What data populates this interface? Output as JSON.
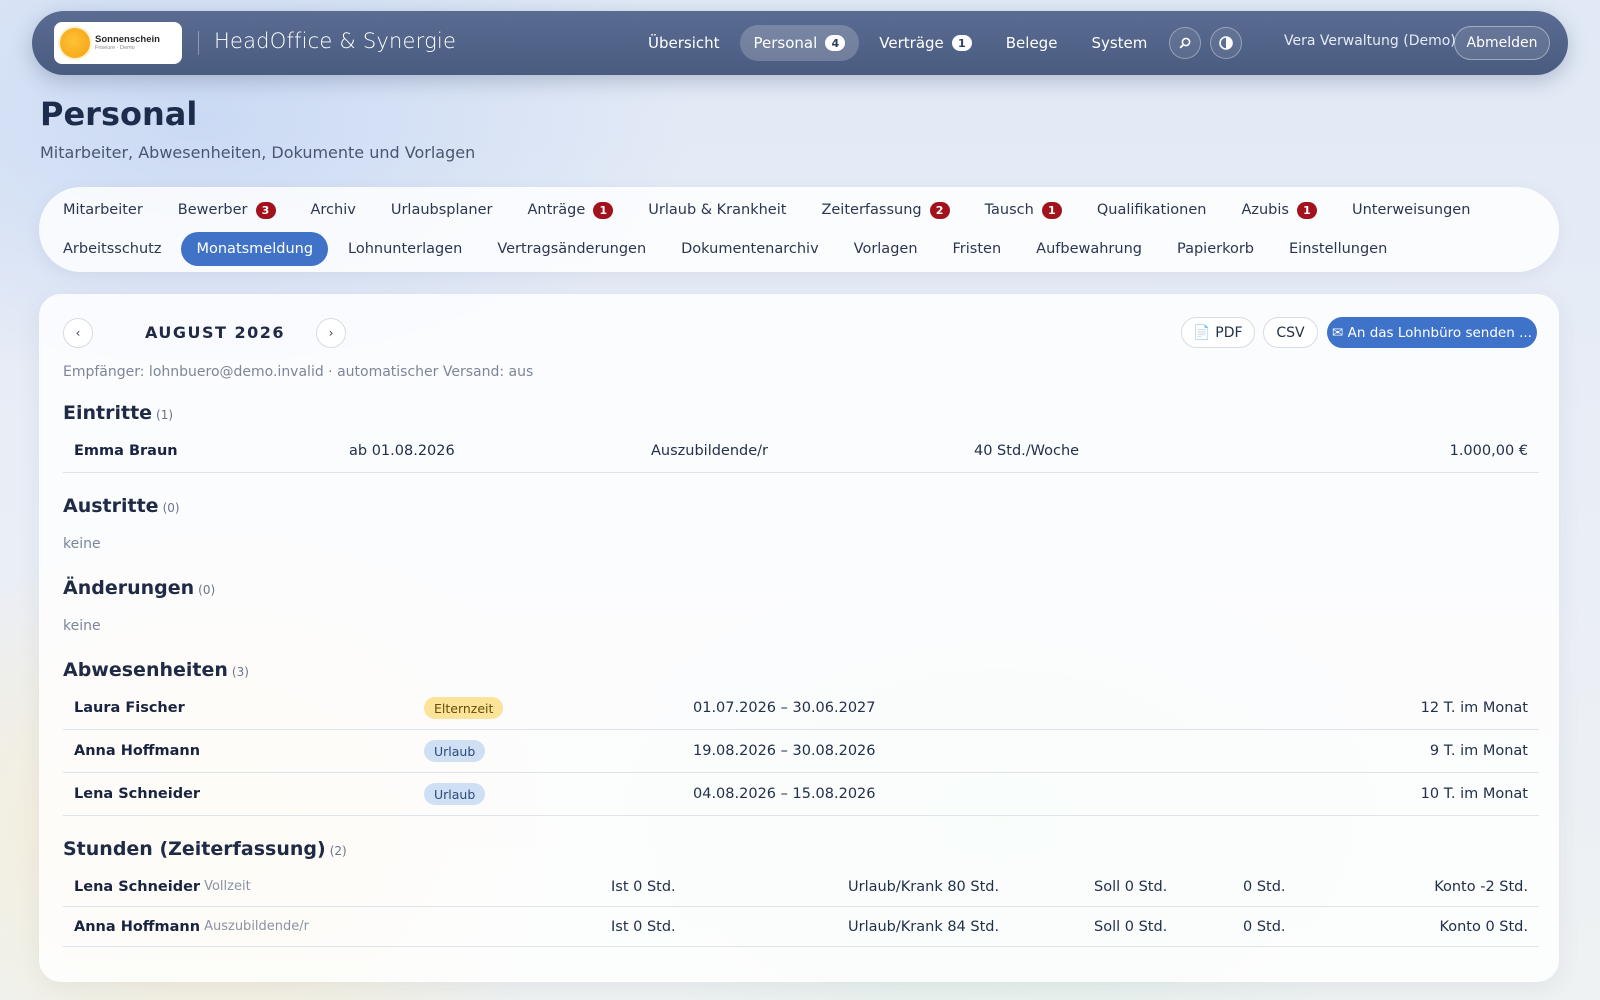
{
  "header": {
    "logo": {
      "name": "Sonnenschein",
      "tagline": "Friseure · Demo"
    },
    "app_title": "HeadOffice & Synergie",
    "nav": [
      {
        "label": "Übersicht",
        "badge": null,
        "active": false
      },
      {
        "label": "Personal",
        "badge": "4",
        "active": true
      },
      {
        "label": "Verträge",
        "badge": "1",
        "active": false
      },
      {
        "label": "Belege",
        "badge": null,
        "active": false
      },
      {
        "label": "System",
        "badge": null,
        "active": false
      }
    ],
    "search_icon": "search-icon",
    "theme_icon": "contrast-icon",
    "user": "Vera Verwaltung (Demo)",
    "logout": "Abmelden"
  },
  "page": {
    "title": "Personal",
    "subtitle": "Mitarbeiter, Abwesenheiten, Dokumente und Vorlagen"
  },
  "subtabs": {
    "row1": [
      {
        "label": "Mitarbeiter",
        "badge": null
      },
      {
        "label": "Bewerber",
        "badge": "3"
      },
      {
        "label": "Archiv",
        "badge": null
      },
      {
        "label": "Urlaubsplaner",
        "badge": null
      },
      {
        "label": "Anträge",
        "badge": "1"
      },
      {
        "label": "Urlaub & Krankheit",
        "badge": null
      },
      {
        "label": "Zeiterfassung",
        "badge": "2"
      },
      {
        "label": "Tausch",
        "badge": "1"
      },
      {
        "label": "Qualifikationen",
        "badge": null
      },
      {
        "label": "Azubis",
        "badge": "1"
      },
      {
        "label": "Unterweisungen",
        "badge": null
      }
    ],
    "row2": [
      {
        "label": "Arbeitsschutz",
        "active": false
      },
      {
        "label": "Monatsmeldung",
        "active": true
      },
      {
        "label": "Lohnunterlagen",
        "active": false
      },
      {
        "label": "Vertragsänderungen",
        "active": false
      },
      {
        "label": "Dokumentenarchiv",
        "active": false
      },
      {
        "label": "Vorlagen",
        "active": false
      },
      {
        "label": "Fristen",
        "active": false
      },
      {
        "label": "Aufbewahrung",
        "active": false
      },
      {
        "label": "Papierkorb",
        "active": false
      },
      {
        "label": "Einstellungen",
        "active": false
      }
    ]
  },
  "report": {
    "prev": "‹",
    "next": "›",
    "month": "AUGUST 2026",
    "pdf": "📄 PDF",
    "csv": "CSV",
    "send": "✉ An das Lohnbüro senden ...",
    "recipient": "Empfänger: lohnbuero@demo.invalid · automatischer Versand: aus",
    "entries": {
      "title": "Eintritte",
      "count": "(1)",
      "rows": [
        {
          "name": "Emma Braun",
          "start": "ab 01.08.2026",
          "role": "Auszubildende/r",
          "hours": "40 Std./Woche",
          "salary": "1.000,00 €"
        }
      ]
    },
    "exits": {
      "title": "Austritte",
      "count": "(0)",
      "empty": "keine"
    },
    "changes": {
      "title": "Änderungen",
      "count": "(0)",
      "empty": "keine"
    },
    "absences": {
      "title": "Abwesenheiten",
      "count": "(3)",
      "rows": [
        {
          "name": "Laura Fischer",
          "type": "Elternzeit",
          "kind": "eltern",
          "period": "01.07.2026 – 30.06.2027",
          "days": "12 T. im Monat"
        },
        {
          "name": "Anna Hoffmann",
          "type": "Urlaub",
          "kind": "urlaub",
          "period": "19.08.2026 – 30.08.2026",
          "days": "9 T. im Monat"
        },
        {
          "name": "Lena Schneider",
          "type": "Urlaub",
          "kind": "urlaub",
          "period": "04.08.2026 – 15.08.2026",
          "days": "10 T. im Monat"
        }
      ]
    },
    "hours": {
      "title": "Stunden (Zeiterfassung)",
      "count": "(2)",
      "rows": [
        {
          "name": "Lena Schneider",
          "role": "Vollzeit",
          "ist": "Ist 0 Std.",
          "absent": "Urlaub/Krank 80 Std.",
          "soll": "Soll 0 Std.",
          "diff": "0 Std.",
          "konto": "Konto -2 Std."
        },
        {
          "name": "Anna Hoffmann",
          "role": "Auszubildende/r",
          "ist": "Ist 0 Std.",
          "absent": "Urlaub/Krank 84 Std.",
          "soll": "Soll 0 Std.",
          "diff": "0 Std.",
          "konto": "Konto 0 Std."
        }
      ]
    }
  }
}
